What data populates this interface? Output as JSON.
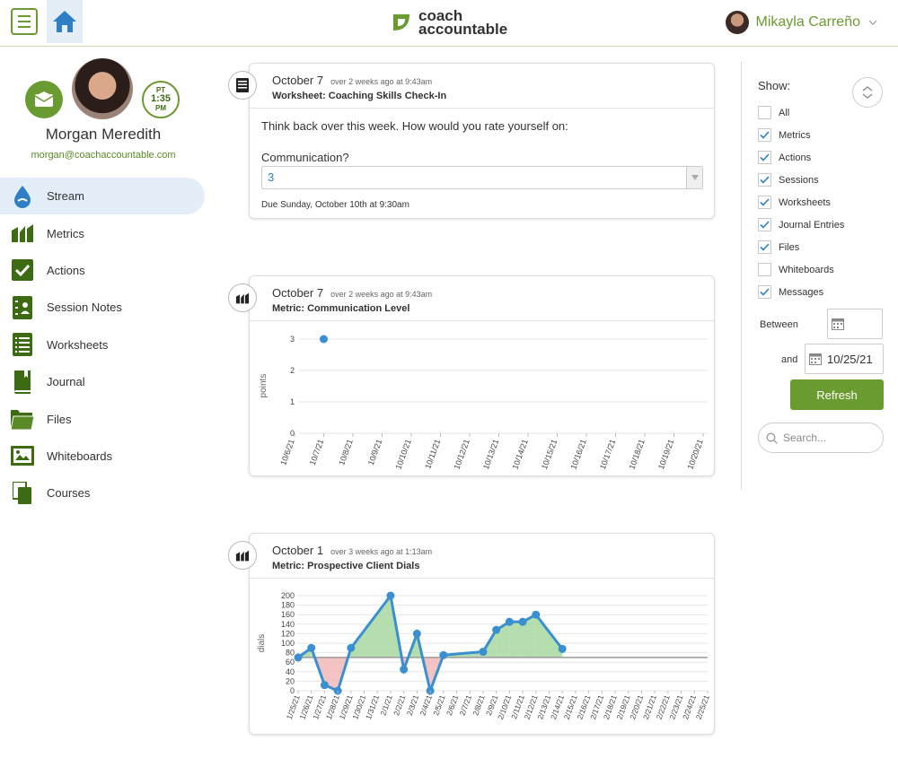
{
  "header": {
    "logo_line1": "coach",
    "logo_line2": "accountable",
    "user_name": "Mikayla Carreño"
  },
  "profile": {
    "timezone": "PT",
    "time": "1:35",
    "ampm": "PM",
    "name": "Morgan Meredith",
    "email": "morgan@coachaccountable.com"
  },
  "nav": [
    {
      "label": "Stream",
      "icon": "stream-drop-icon",
      "active": true
    },
    {
      "label": "Metrics",
      "icon": "metrics-chart-icon"
    },
    {
      "label": "Actions",
      "icon": "actions-check-icon"
    },
    {
      "label": "Session Notes",
      "icon": "session-notes-icon"
    },
    {
      "label": "Worksheets",
      "icon": "worksheets-list-icon"
    },
    {
      "label": "Journal",
      "icon": "journal-book-icon"
    },
    {
      "label": "Files",
      "icon": "files-folder-icon"
    },
    {
      "label": "Whiteboards",
      "icon": "whiteboard-icon"
    },
    {
      "label": "Courses",
      "icon": "courses-copy-icon"
    }
  ],
  "cards": {
    "worksheet": {
      "date": "October 7",
      "ago": "over 2 weeks ago at 9:43am",
      "title": "Worksheet: Coaching Skills Check-In",
      "question": "Think back over this week. How would you rate yourself on:",
      "field_label": "Communication?",
      "field_value": "3",
      "due": "Due Sunday, October 10th at 9:30am"
    },
    "metric1": {
      "date": "October 7",
      "ago": "over 2 weeks ago at 9:43am",
      "title": "Metric: Communication Level"
    },
    "metric2": {
      "date": "October 1",
      "ago": "over 3 weeks ago at 1:13am",
      "title": "Metric: Prospective Client Dials"
    }
  },
  "chart_data": [
    {
      "type": "line",
      "ylabel": "points",
      "ylim": [
        0,
        3
      ],
      "yticks": [
        "0",
        "1",
        "2",
        "3"
      ],
      "categories": [
        "10/6/21",
        "10/7/21",
        "10/8/21",
        "10/9/21",
        "10/10/21",
        "10/11/21",
        "10/12/21",
        "10/13/21",
        "10/14/21",
        "10/15/21",
        "10/16/21",
        "10/17/21",
        "10/18/21",
        "10/19/21",
        "10/20/21"
      ],
      "points": [
        {
          "x": "10/7/21",
          "y": 3
        }
      ],
      "series_color": "#3a8fd0"
    },
    {
      "type": "area",
      "ylabel": "dials",
      "ylim": [
        0,
        200
      ],
      "goal": 70,
      "yticks": [
        "0",
        "20",
        "40",
        "60",
        "80",
        "100",
        "120",
        "140",
        "160",
        "180",
        "200"
      ],
      "categories": [
        "1/25/21",
        "1/26/21",
        "1/27/21",
        "1/28/21",
        "1/29/21",
        "1/30/21",
        "1/31/21",
        "2/1/21",
        "2/2/21",
        "2/3/21",
        "2/4/21",
        "2/5/21",
        "2/6/21",
        "2/7/21",
        "2/8/21",
        "2/9/21",
        "2/10/21",
        "2/11/21",
        "2/12/21",
        "2/13/21",
        "2/14/21",
        "2/15/21",
        "2/16/21",
        "2/17/21",
        "2/18/21",
        "2/19/21",
        "2/20/21",
        "2/21/21",
        "2/22/21",
        "2/23/21",
        "2/24/21",
        "2/25/21"
      ],
      "points": [
        {
          "x": 0,
          "y": 70
        },
        {
          "x": 1,
          "y": 90
        },
        {
          "x": 2,
          "y": 12
        },
        {
          "x": 3,
          "y": 0
        },
        {
          "x": 4,
          "y": 90
        },
        {
          "x": 7,
          "y": 200
        },
        {
          "x": 8,
          "y": 45
        },
        {
          "x": 9,
          "y": 120
        },
        {
          "x": 10,
          "y": 0
        },
        {
          "x": 11,
          "y": 75
        },
        {
          "x": 14,
          "y": 82
        },
        {
          "x": 15,
          "y": 128
        },
        {
          "x": 16,
          "y": 145
        },
        {
          "x": 17,
          "y": 145
        },
        {
          "x": 18,
          "y": 160
        },
        {
          "x": 20,
          "y": 88
        }
      ],
      "series_color": "#3a8fd0",
      "above_color": "#a8d8a0",
      "below_color": "#f2b8b8"
    }
  ],
  "filter": {
    "show_label": "Show:",
    "items": [
      {
        "label": "All",
        "checked": false
      },
      {
        "label": "Metrics",
        "checked": true
      },
      {
        "label": "Actions",
        "checked": true
      },
      {
        "label": "Sessions",
        "checked": true
      },
      {
        "label": "Worksheets",
        "checked": true
      },
      {
        "label": "Journal Entries",
        "checked": true
      },
      {
        "label": "Files",
        "checked": true
      },
      {
        "label": "Whiteboards",
        "checked": false
      },
      {
        "label": "Messages",
        "checked": true
      }
    ],
    "between_label": "Between",
    "between_value": "",
    "and_label": "and",
    "and_value": "10/25/21",
    "refresh_label": "Refresh",
    "search_placeholder": "Search..."
  },
  "colors": {
    "brand_green": "#6a9b30",
    "accent_blue": "#2e7fc2"
  }
}
